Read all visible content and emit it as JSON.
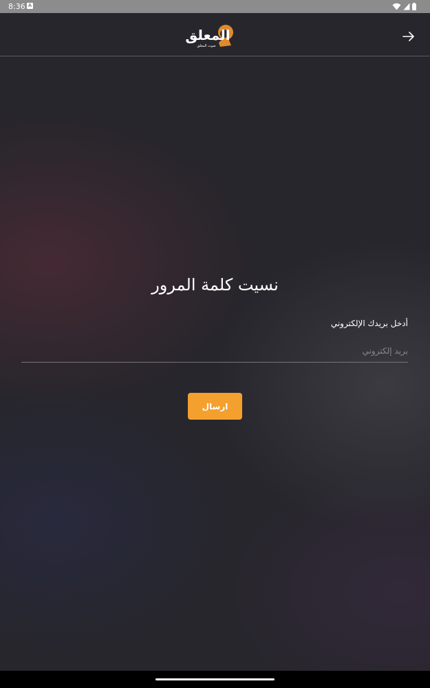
{
  "status_bar": {
    "time": "8:36",
    "notification_icon": "a-badge-icon",
    "icons": [
      "wifi-icon",
      "signal-icon",
      "battery-icon"
    ]
  },
  "header": {
    "logo_text": "المعلق",
    "logo_tagline": "صوت المعلق",
    "back_icon": "arrow-right-icon"
  },
  "page": {
    "title": "نسيت كلمة المرور"
  },
  "form": {
    "email_label": "أدخل بريدك الإلكتروني",
    "email_value": "",
    "email_placeholder": "بريد إلكتروني",
    "submit_label": "ارسال"
  },
  "colors": {
    "accent": "#f4a02f",
    "background": "#27262c",
    "status_bar": "#8c8c8c"
  }
}
